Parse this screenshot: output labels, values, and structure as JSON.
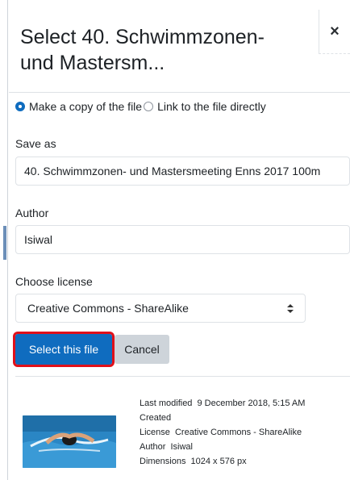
{
  "dialog": {
    "title": "Select 40. Schwimmzonen- und Mastersm...",
    "close_label": "×"
  },
  "link_options": {
    "copy_label": "Make a copy of the file",
    "copy_selected": true,
    "link_label": "Link to the file directly",
    "link_selected": false
  },
  "save_as": {
    "label": "Save as",
    "value": "40. Schwimmzonen- und Mastersmeeting Enns 2017 100m"
  },
  "author": {
    "label": "Author",
    "value": "Isiwal"
  },
  "license": {
    "label": "Choose license",
    "selected": "Creative Commons - ShareAlike"
  },
  "buttons": {
    "select": "Select this file",
    "cancel": "Cancel"
  },
  "file_info": {
    "last_modified_label": "Last modified",
    "last_modified_value": "9 December 2018, 5:15 AM",
    "created_label": "Created",
    "license_label": "License",
    "license_value": "Creative Commons - ShareAlike",
    "author_label": "Author",
    "author_value": "Isiwal",
    "dimensions_label": "Dimensions",
    "dimensions_value": "1024 x 576 px"
  },
  "colors": {
    "primary": "#0f6cbf",
    "highlight": "#e0101a",
    "secondary_button": "#ced4da",
    "water": "#2a86c4"
  },
  "icons": {
    "close": "close-icon",
    "select_arrows": "chevron-up-down-icon",
    "thumbnail": "swimmer-thumbnail"
  }
}
